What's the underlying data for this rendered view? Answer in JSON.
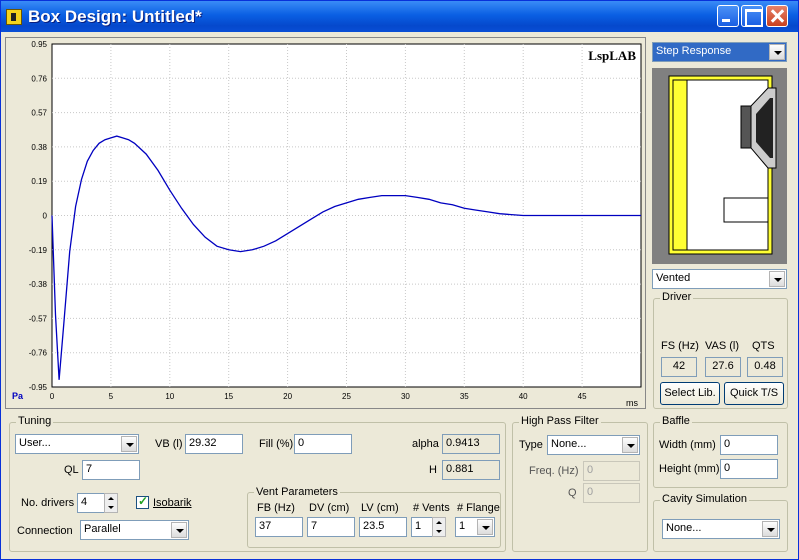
{
  "window": {
    "title": "Box Design: Untitled*"
  },
  "chart_data": {
    "type": "line",
    "brand": "LspLAB",
    "ylabel": "Pa",
    "xlabel": "ms",
    "xlim": [
      0,
      50
    ],
    "ylim": [
      -0.95,
      0.95
    ],
    "yticks": [
      "0.95",
      "0.76",
      "0.57",
      "0.38",
      "0.19",
      "0",
      "-0.19",
      "-0.38",
      "-0.57",
      "-0.76",
      "-0.95"
    ],
    "xticks": [
      "0",
      "5",
      "10",
      "15",
      "20",
      "25",
      "30",
      "35",
      "40",
      "45"
    ],
    "line_color": "#0000c0",
    "series": [
      {
        "x": [
          0,
          0.3,
          0.6,
          1,
          1.5,
          2,
          2.5,
          3,
          3.5,
          4,
          4.5,
          5,
          5.5,
          6,
          6.5,
          7,
          8,
          9,
          10,
          11,
          12,
          13,
          14,
          15,
          16,
          17,
          18,
          19,
          20,
          21,
          22,
          23,
          24,
          25,
          26,
          27,
          28,
          29,
          30,
          31,
          32,
          33,
          34,
          35,
          36,
          37,
          38,
          39,
          40,
          41,
          42,
          43,
          44,
          45,
          46,
          47,
          48,
          49,
          50
        ],
        "y": [
          0,
          -0.55,
          -0.91,
          -0.6,
          -0.2,
          0.05,
          0.2,
          0.3,
          0.36,
          0.4,
          0.42,
          0.43,
          0.44,
          0.43,
          0.42,
          0.4,
          0.34,
          0.25,
          0.14,
          0.04,
          -0.05,
          -0.12,
          -0.17,
          -0.19,
          -0.2,
          -0.19,
          -0.17,
          -0.14,
          -0.1,
          -0.06,
          -0.02,
          0.02,
          0.05,
          0.07,
          0.09,
          0.1,
          0.11,
          0.11,
          0.11,
          0.1,
          0.09,
          0.07,
          0.06,
          0.04,
          0.03,
          0.02,
          0.01,
          0.005,
          0,
          0,
          0,
          0,
          0,
          0,
          0,
          0,
          0,
          0,
          0
        ]
      }
    ],
    "grid": true
  },
  "right": {
    "view_select": "Step Response",
    "box_type": "Vented",
    "driver": {
      "legend": "Driver",
      "headers": [
        "FS (Hz)",
        "VAS (l)",
        "QTS"
      ],
      "values": [
        "42",
        "27.6",
        "0.48"
      ],
      "select_lib": "Select Lib.",
      "quick_ts": "Quick T/S"
    },
    "baffle": {
      "legend": "Baffle",
      "width_label": "Width (mm)",
      "width": "0",
      "height_label": "Height (mm)",
      "height": "0"
    },
    "cavity": {
      "legend": "Cavity Simulation",
      "value": "None..."
    }
  },
  "tuning": {
    "legend": "Tuning",
    "mode": "User...",
    "vb_label": "VB (l)",
    "vb": "29.32",
    "fill_label": "Fill (%)",
    "fill": "0",
    "alpha_label": "alpha",
    "alpha": "0.9413",
    "ql_label": "QL",
    "ql": "7",
    "h_label": "H",
    "h": "0.881",
    "drivers_label": "No. drivers",
    "drivers": "4",
    "isobarik_label": "Isobarik",
    "connection_label": "Connection",
    "connection": "Parallel"
  },
  "vent": {
    "legend": "Vent Parameters",
    "headers": [
      "FB (Hz)",
      "DV (cm)",
      "LV (cm)",
      "# Vents",
      "# Flange"
    ],
    "values": [
      "37",
      "7",
      "23.5",
      "1",
      "1"
    ]
  },
  "hpf": {
    "legend": "High Pass Filter",
    "type_label": "Type",
    "type": "None...",
    "freq_label": "Freq. (Hz)",
    "freq": "0",
    "q_label": "Q",
    "q": "0"
  }
}
